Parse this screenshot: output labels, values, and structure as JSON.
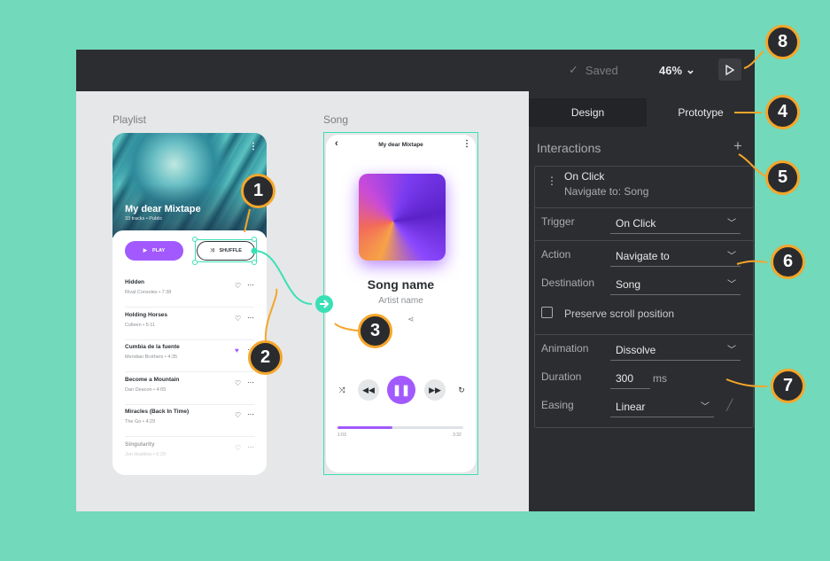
{
  "topbar": {
    "saved_label": "Saved",
    "zoom": "46%"
  },
  "canvas": {
    "playlist_label": "Playlist",
    "song_label": "Song",
    "playlist": {
      "title": "My dear Mixtape",
      "subtitle": "33 tracks • Public",
      "play_label": "PLAY",
      "shuffle_label": "SHUFFLE",
      "songs": [
        {
          "title": "Hidden",
          "artist": "Rival Consoles • 7:38",
          "liked": false
        },
        {
          "title": "Holding Horses",
          "artist": "Colleen • 5:11",
          "liked": false
        },
        {
          "title": "Cumbia de la fuente",
          "artist": "Meridian Brothers • 4:35",
          "liked": true
        },
        {
          "title": "Become a Mountain",
          "artist": "Dan Deacon • 4:05",
          "liked": false
        },
        {
          "title": "Miracles (Back In Time)",
          "artist": "The Go • 4:29",
          "liked": false
        },
        {
          "title": "Singularity",
          "artist": "Jon Hopkins • 6:29",
          "liked": false
        }
      ]
    },
    "song": {
      "header": "My dear Mixtape",
      "name": "Song name",
      "artist": "Artist name",
      "time_start": "1:03",
      "time_end": "3:32",
      "progress": 0.44
    }
  },
  "panel": {
    "tab_design": "Design",
    "tab_prototype": "Prototype",
    "interactions_title": "Interactions",
    "interaction": {
      "event": "On Click",
      "summary": "Navigate to: Song"
    },
    "trigger_label": "Trigger",
    "trigger_value": "On Click",
    "action_label": "Action",
    "action_value": "Navigate to",
    "destination_label": "Destination",
    "destination_value": "Song",
    "preserve_label": "Preserve scroll position",
    "animation_label": "Animation",
    "animation_value": "Dissolve",
    "duration_label": "Duration",
    "duration_value": "300",
    "duration_unit": "ms",
    "easing_label": "Easing",
    "easing_value": "Linear"
  },
  "callouts": [
    "1",
    "2",
    "3",
    "4",
    "5",
    "6",
    "7",
    "8"
  ],
  "colors": {
    "background": "#72d9ba",
    "accent": "#a259ff",
    "connector": "#3ae0b5",
    "callout_border": "#f5a62a"
  }
}
